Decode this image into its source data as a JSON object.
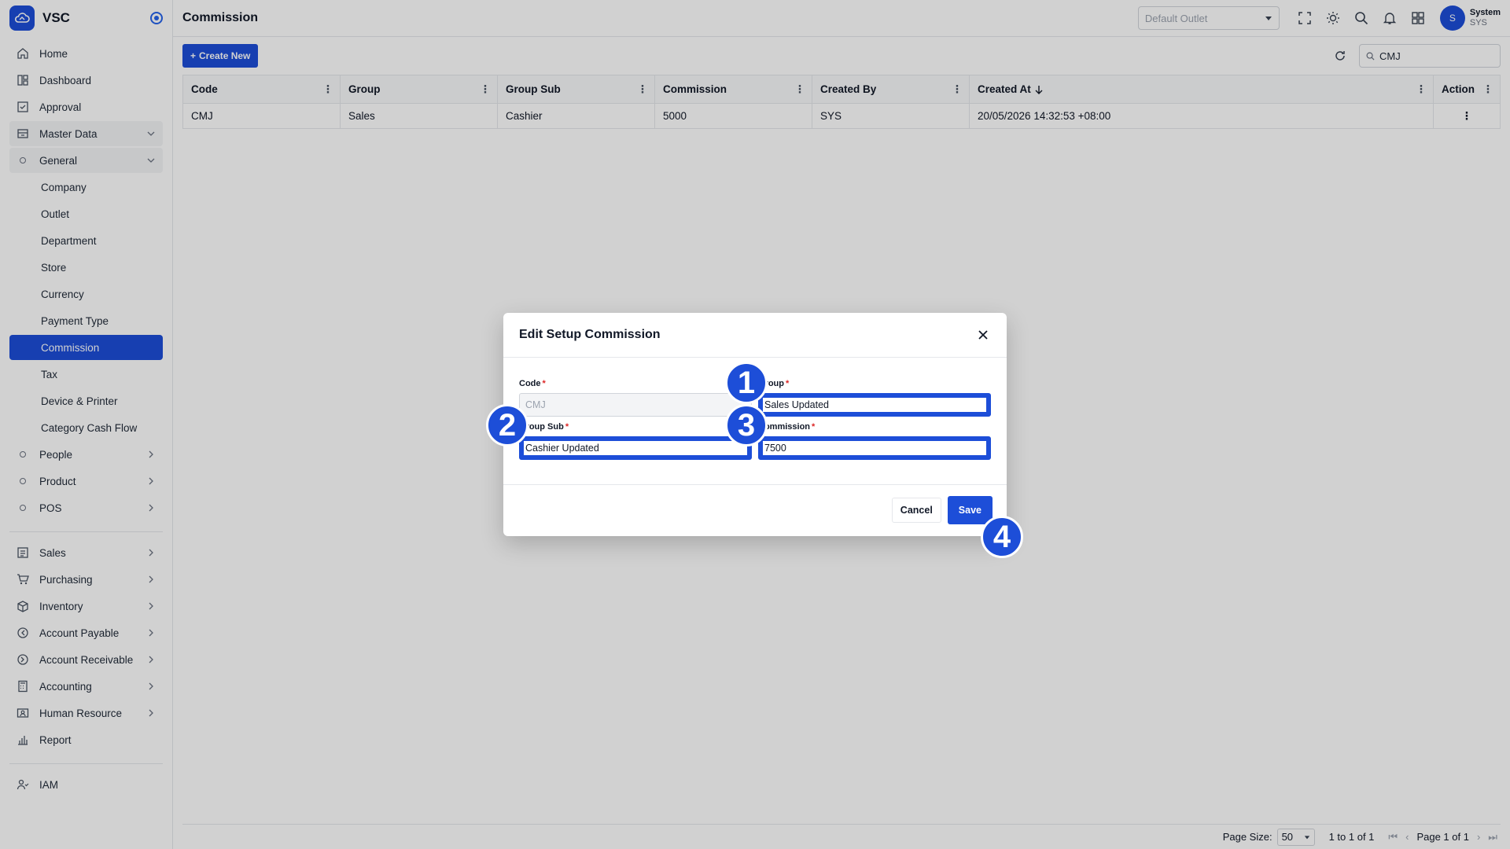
{
  "app": {
    "name": "VSC"
  },
  "sidebar": {
    "items": [
      {
        "label": "Home",
        "icon": "home-icon"
      },
      {
        "label": "Dashboard",
        "icon": "dashboard-icon"
      },
      {
        "label": "Approval",
        "icon": "approval-icon"
      },
      {
        "label": "Master Data",
        "icon": "master-data-icon"
      },
      {
        "label": "General"
      },
      {
        "label": "Company"
      },
      {
        "label": "Outlet"
      },
      {
        "label": "Department"
      },
      {
        "label": "Store"
      },
      {
        "label": "Currency"
      },
      {
        "label": "Payment Type"
      },
      {
        "label": "Commission"
      },
      {
        "label": "Tax"
      },
      {
        "label": "Device & Printer"
      },
      {
        "label": "Category Cash Flow"
      },
      {
        "label": "People"
      },
      {
        "label": "Product"
      },
      {
        "label": "POS"
      },
      {
        "label": "Sales",
        "icon": "sales-icon"
      },
      {
        "label": "Purchasing",
        "icon": "cart-icon"
      },
      {
        "label": "Inventory",
        "icon": "box-icon"
      },
      {
        "label": "Account Payable",
        "icon": "payable-icon"
      },
      {
        "label": "Account Receivable",
        "icon": "receivable-icon"
      },
      {
        "label": "Accounting",
        "icon": "calculator-icon"
      },
      {
        "label": "Human Resource",
        "icon": "person-card-icon"
      },
      {
        "label": "Report",
        "icon": "report-icon"
      },
      {
        "label": "IAM",
        "icon": "users-icon"
      }
    ]
  },
  "header": {
    "title": "Commission",
    "outlet_placeholder": "Default Outlet",
    "user_name": "System",
    "user_code": "SYS",
    "avatar_initial": "S"
  },
  "toolbar": {
    "create_label": "Create New",
    "search_value": "CMJ"
  },
  "table": {
    "columns": [
      "Code",
      "Group",
      "Group Sub",
      "Commission",
      "Created By",
      "Created At",
      "Action"
    ],
    "rows": [
      {
        "code": "CMJ",
        "group": "Sales",
        "group_sub": "Cashier",
        "commission": "5000",
        "created_by": "SYS",
        "created_at": "20/05/2026 14:32:53 +08:00"
      }
    ]
  },
  "footer": {
    "page_size_label": "Page Size:",
    "page_size": "50",
    "range": "1 to 1 of 1",
    "page_label": "Page 1 of 1"
  },
  "modal": {
    "title": "Edit Setup Commission",
    "code_label": "Code",
    "code_value": "CMJ",
    "group_label": "Group",
    "group_value": "Sales Updated",
    "group_sub_label": "Group Sub",
    "group_sub_value": "Cashier Updated",
    "commission_label": "Commission",
    "commission_value": "7500",
    "required_mark": "*",
    "cancel_label": "Cancel",
    "save_label": "Save"
  },
  "markers": [
    "1",
    "2",
    "3",
    "4"
  ],
  "colors": {
    "primary": "#1d4ed8",
    "required": "#dc2626"
  }
}
